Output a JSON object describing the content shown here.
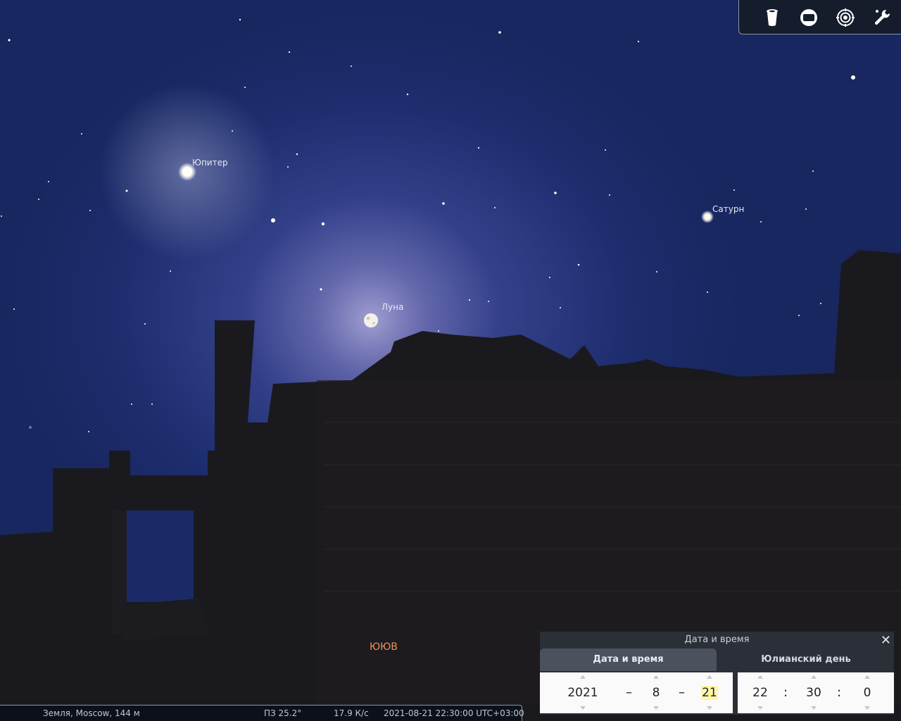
{
  "sky": {
    "labels": {
      "jupiter": "Юпитер",
      "moon": "Луна",
      "saturn": "Сатурн"
    },
    "compass": "ЮЮВ"
  },
  "toolbar": {
    "icons": [
      "trash-can-icon",
      "screen-rect-icon",
      "target-icon",
      "wrench-icon"
    ]
  },
  "status_bar": {
    "location": "Земля, Moscow, 144 м",
    "fov": "ПЗ 25.2°",
    "fps": "17.9 К/с",
    "datetime": "2021-08-21 22:30:00 UTC+03:00"
  },
  "datetime_dialog": {
    "title": "Дата и время",
    "close": "✕",
    "tabs": {
      "date_time": "Дата и время",
      "julian": "Юлианский день"
    },
    "date": {
      "year": "2021",
      "sep1": "–",
      "month": "8",
      "sep2": "–",
      "day": "21"
    },
    "time": {
      "hour": "22",
      "sep1": ":",
      "minute": "30",
      "sep2": ":",
      "second": "0"
    }
  },
  "colors": {
    "sky": "#1d2d6e",
    "compass": "#f0925a",
    "highlight": "#fff6a8"
  }
}
